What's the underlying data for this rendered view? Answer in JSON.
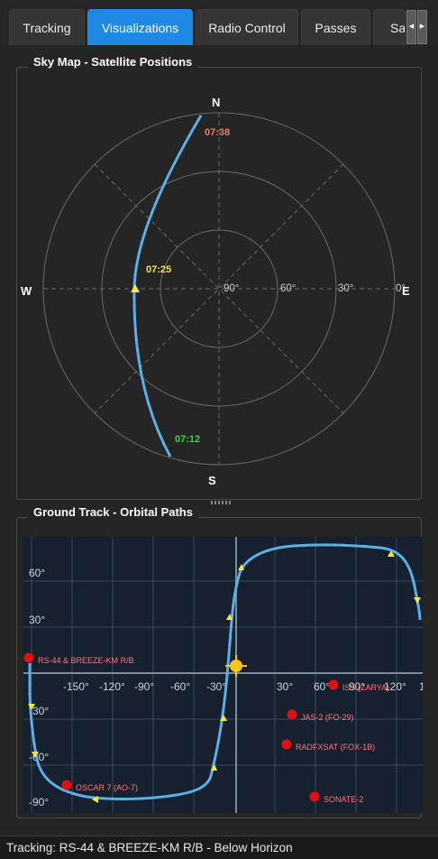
{
  "tabs": [
    {
      "label": "Tracking",
      "active": false
    },
    {
      "label": "Visualizations",
      "active": true
    },
    {
      "label": "Radio Control",
      "active": false
    },
    {
      "label": "Passes",
      "active": false
    },
    {
      "label": "Satellites",
      "active": false
    }
  ],
  "tab_scroll": {
    "left_icon": "chevron-left-icon",
    "right_icon": "chevron-right-icon",
    "left": "◀",
    "right": "▶"
  },
  "sky_map": {
    "title": "Sky Map - Satellite Positions",
    "cardinals": {
      "north": "N",
      "south": "S",
      "east": "E",
      "west": "W"
    },
    "ring_labels": [
      "90°",
      "60°",
      "30°",
      "0°"
    ],
    "pass_times": {
      "aos": "07:12",
      "max": "07:25",
      "los": "07:38"
    },
    "colors": {
      "track": "#5aaee6",
      "aos": "#3ed43e",
      "max": "#f5e63c",
      "los": "#f07a6e",
      "grid": "#6a6a6a"
    }
  },
  "ground_track": {
    "title": "Ground Track - Orbital Paths",
    "lat_labels": [
      "60°",
      "30°",
      "-30°",
      "-60°",
      "-90°"
    ],
    "lon_labels": [
      "-150°",
      "-120°",
      "-90°",
      "-60°",
      "-30°",
      "30°",
      "60°",
      "90°",
      "120°",
      "1"
    ],
    "satellites": [
      {
        "name": "RS-44 & BREEZE-KM R/B",
        "lon": -176,
        "lat": 10,
        "tracked": true
      },
      {
        "name": "ISS (ZARYA)",
        "lon": 65,
        "lat": -8
      },
      {
        "name": "JAS-2 (FO-29)",
        "lon": 37,
        "lat": -27
      },
      {
        "name": "RADFXSAT (FOX-1B)",
        "lon": 33,
        "lat": -46
      },
      {
        "name": "OSCAR 7 (AO-7)",
        "lon": -153,
        "lat": -72
      },
      {
        "name": "SONATE-2",
        "lon": 52,
        "lat": -80
      }
    ],
    "sun_icon": "sun-icon",
    "colors": {
      "track": "#5aaee6",
      "sat": "#e01010",
      "label": "#ff7777",
      "sun": "#f5c518",
      "bg": "#16202e",
      "grid": "#3a4a5e"
    }
  },
  "status": {
    "text": "Tracking: RS-44 & BREEZE-KM R/B - Below Horizon"
  }
}
